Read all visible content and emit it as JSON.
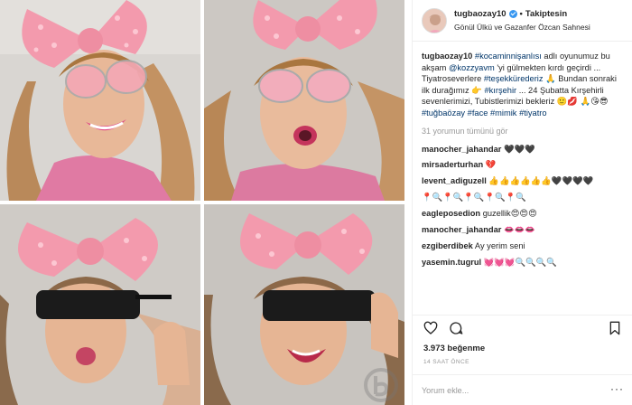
{
  "post": {
    "username": "tugbaozay10",
    "follow_status": "Takiptesin",
    "location": "Gönül Ülkü ve Gazanfer Özcan Sahnesi",
    "caption": {
      "username": "tugbaozay10",
      "t1": "#kocaminnişanlısı",
      "t2": " adlı oyunumuz bu akşam ",
      "t3": "@kozzyavm",
      "t4": " 'yi gülmekten kırdı geçirdi ... Tiyatroseverlere ",
      "t5": "#teşekkürederiz",
      "t6": " 🙏 Bundan sonraki ilk durağımız 👉 ",
      "t7": "#kırşehir",
      "t8": " ... 24 Şubatta Kırşehirli sevenlerimizi, Tubistlerimizi bekleriz 🙂💋 🙏😘😎 ",
      "t9": "#tuğbaözay",
      "t10": " ",
      "t11": "#face",
      "t12": " ",
      "t13": "#mimik",
      "t14": " ",
      "t15": "#tiyatro"
    },
    "see_all": "31 yorumun tümünü gör",
    "comments": [
      {
        "user": "manocher_jahandar",
        "text": "🖤🖤🖤"
      },
      {
        "user": "mirsaderturhan",
        "text": "💔"
      },
      {
        "user": "levent_adiguzell",
        "text": "👍👍👍👍👍👍🖤🖤🖤🖤"
      },
      {
        "user": "",
        "text": "📍🔍📍🔍📍🔍📍🔍📍🔍"
      },
      {
        "user": "eagleposedion",
        "text": "guzellik😍😍😍"
      },
      {
        "user": "manocher_jahandar",
        "text": "👄👄👄"
      },
      {
        "user": "ezgiberdibek",
        "text": "Ay yerim seni"
      },
      {
        "user": "yasemin.tugrul",
        "text": "💓💓💓🔍🔍🔍🔍"
      }
    ],
    "likes": "3.973 beğenme",
    "time": "14 SAAT ÖNCE",
    "comment_placeholder": "Yorum ekle...",
    "more": "···"
  },
  "icons": {
    "like": "heart-icon",
    "comment": "comment-icon",
    "save": "bookmark-icon",
    "verified": "verified-badge-icon"
  },
  "colors": {
    "link": "#003569",
    "verified": "#3897f0",
    "muted": "#999999",
    "border": "#efefef"
  }
}
